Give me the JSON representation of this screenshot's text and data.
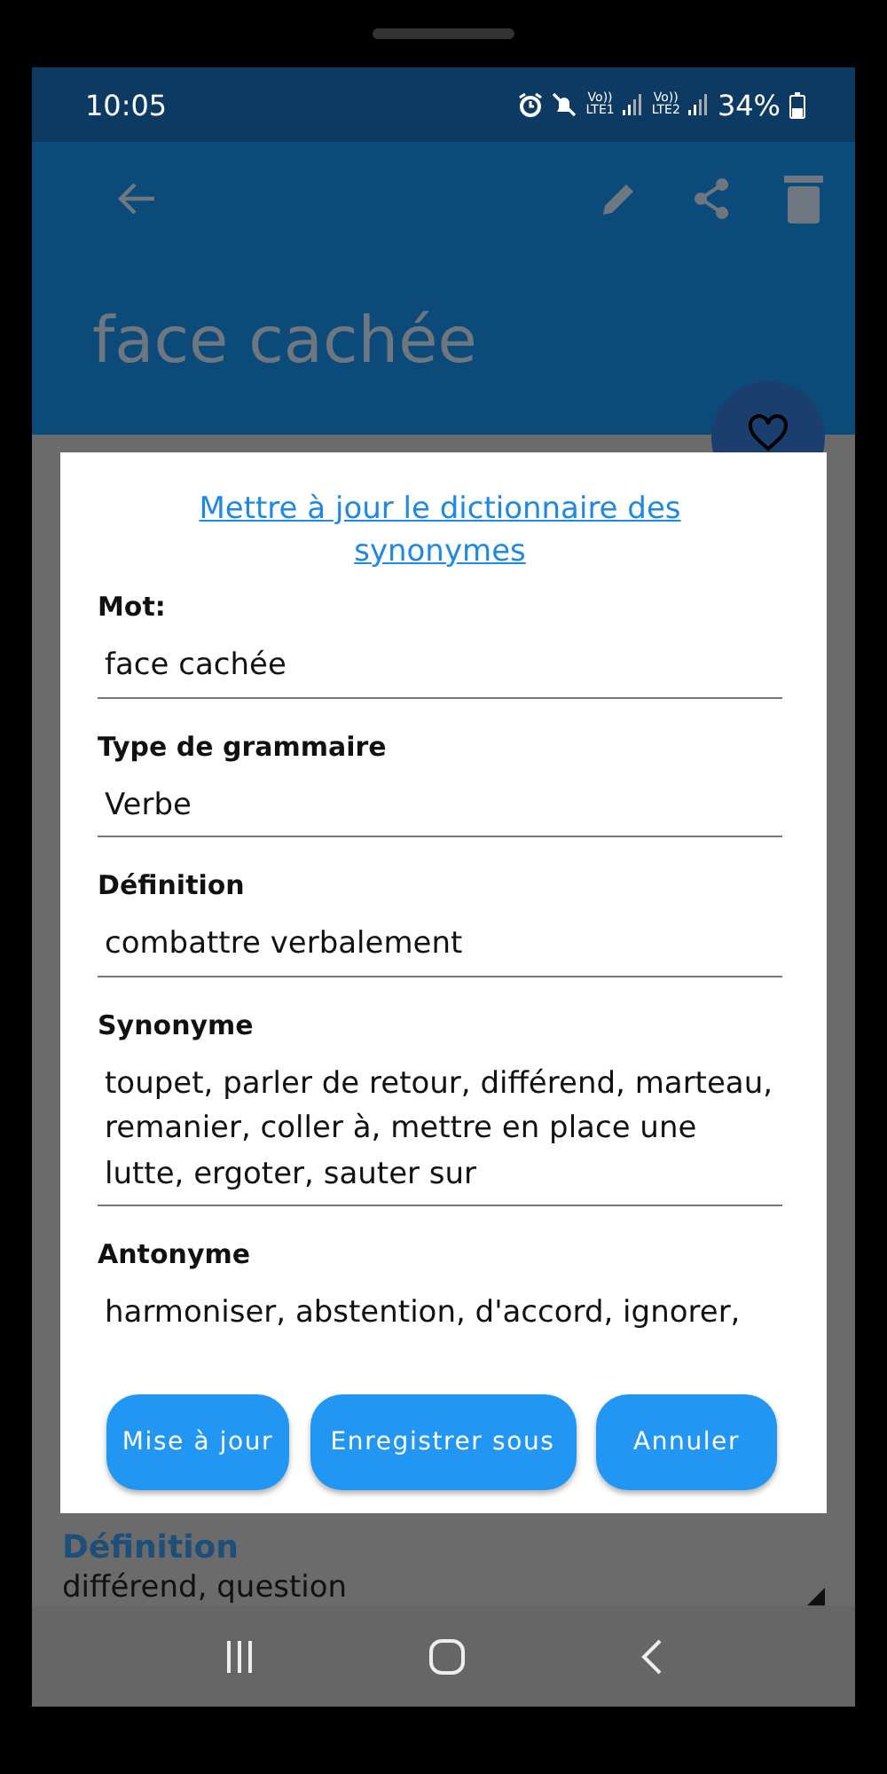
{
  "status_bar": {
    "time": "10:05",
    "sims": [
      {
        "volte": "Vo))",
        "network": "LTE1"
      },
      {
        "volte": "Vo))",
        "network": "LTE2"
      }
    ],
    "battery": "34%"
  },
  "app_bar": {
    "title": "face cachée"
  },
  "background": {
    "section_label": "Définition",
    "text": "différend, question"
  },
  "dialog": {
    "title": "Mettre à jour le dictionnaire des synonymes",
    "fields": [
      {
        "label": "Mot:",
        "value": "face cachée"
      },
      {
        "label": "Type de grammaire",
        "value": "Verbe"
      },
      {
        "label": "Définition",
        "value": "combattre verbalement"
      },
      {
        "label": "Synonyme",
        "value": "toupet, parler de retour, différend, marteau, remanier, coller à, mettre en place une lutte, ergoter, sauter sur"
      },
      {
        "label": "Antonyme",
        "value": "harmoniser, abstention, d'accord, ignorer,"
      }
    ],
    "buttons": [
      "Mise à jour",
      "Enregistrer sous",
      "Annuler"
    ]
  }
}
